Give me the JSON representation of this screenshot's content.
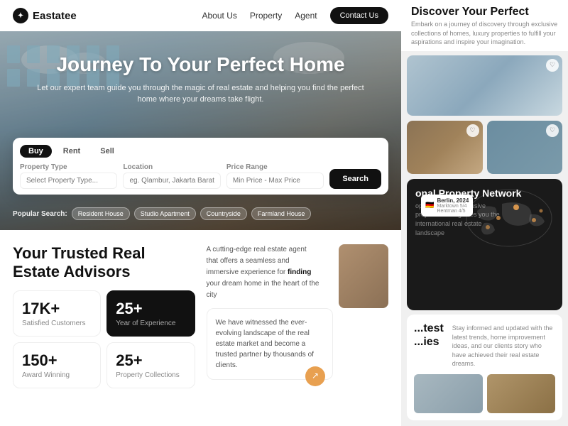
{
  "navbar": {
    "logo": "Eastatee",
    "links": [
      "About Us",
      "Property",
      "Agent"
    ],
    "cta": "Contact Us"
  },
  "hero": {
    "title": "Journey To Your Perfect Home",
    "subtitle": "Let our expert team guide you through the magic of real estate and helping you find the perfect home where your dreams take flight.",
    "search_tabs": [
      "Buy",
      "Rent",
      "Sell"
    ],
    "active_tab": "Buy",
    "fields": {
      "property_type_label": "Property Type",
      "property_type_placeholder": "Select Property Type...",
      "location_label": "Location",
      "location_placeholder": "eg. Qlambur, Jakarta Barat",
      "price_range_label": "Price Range",
      "price_range_placeholder": "Min Price - Max Price"
    },
    "search_btn": "Search",
    "popular_label": "Popular Search:",
    "tags": [
      "Resident House",
      "Studio Apartment",
      "Countryside",
      "Farmland House"
    ]
  },
  "advisors": {
    "title": "Your Trusted Real\nEstate Advisors",
    "description": "A cutting-edge real estate agent that offers a seamless and immersive experience for finding your dream home in the heart of the city",
    "stats": [
      {
        "number": "17K+",
        "label": "Satisfied Customers",
        "dark": false
      },
      {
        "number": "25+",
        "label": "Year of Experience",
        "dark": true
      },
      {
        "number": "150+",
        "label": "Award Winning",
        "dark": false
      },
      {
        "number": "25+",
        "label": "Property Collections",
        "dark": false
      }
    ]
  },
  "partner": {
    "text": "We have witnessed the ever-evolving landscape of the real estate market and become a trusted partner by thousands of clients."
  },
  "discover": {
    "title": "Discover Your Perfect",
    "subtitle": "Embark on a journey of discovery through exclusive collections of homes, luxury properties to fulfill your aspirations and inspire your imagination."
  },
  "network": {
    "title": "onal Property Network",
    "subtitle": "opens doors to exclusive properties and guides you the international real estate landscape",
    "location_label": "Berlin, 2024",
    "location_sub": "Marktown 5/4\nRentman 4/5"
  },
  "latest": {
    "title": "test\nies",
    "subtitle": "Stay informed and updated with the latest trends, home improvement ideas, and our clients story who have achieved their real estate dreams."
  },
  "icons": {
    "logo_icon": "✦",
    "heart": "♡",
    "flag": "🇩🇪",
    "arrow": "↗"
  }
}
